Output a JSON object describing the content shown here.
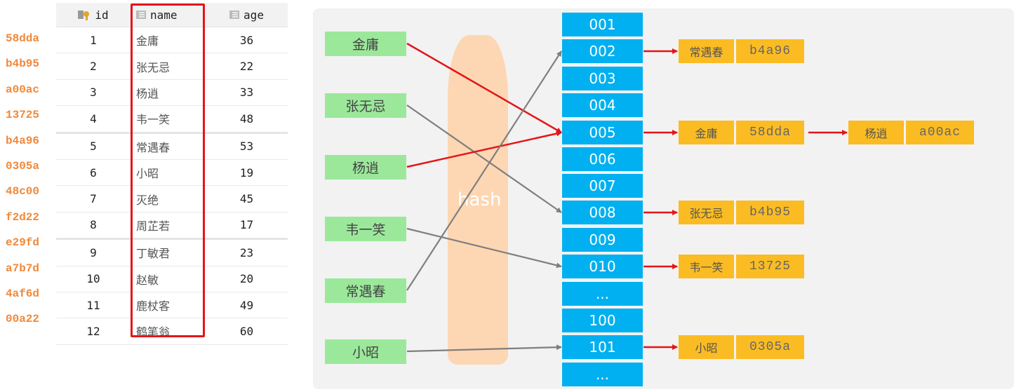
{
  "table": {
    "columns": [
      {
        "label": "id",
        "icon": "primary-key-icon"
      },
      {
        "label": "name",
        "icon": "column-icon"
      },
      {
        "label": "age",
        "icon": "column-icon"
      }
    ],
    "rows": [
      {
        "hash": "58dda",
        "id": "1",
        "name": "金庸",
        "age": "36"
      },
      {
        "hash": "b4b95",
        "id": "2",
        "name": "张无忌",
        "age": "22"
      },
      {
        "hash": "a00ac",
        "id": "3",
        "name": "杨逍",
        "age": "33"
      },
      {
        "hash": "13725",
        "id": "4",
        "name": "韦一笑",
        "age": "48"
      },
      {
        "hash": "b4a96",
        "id": "5",
        "name": "常遇春",
        "age": "53"
      },
      {
        "hash": "0305a",
        "id": "6",
        "name": "小昭",
        "age": "19"
      },
      {
        "hash": "48c00",
        "id": "7",
        "name": "灭绝",
        "age": "45"
      },
      {
        "hash": "f2d22",
        "id": "8",
        "name": "周芷若",
        "age": "17"
      },
      {
        "hash": "e29fd",
        "id": "9",
        "name": "丁敏君",
        "age": "23"
      },
      {
        "hash": "a7b7d",
        "id": "10",
        "name": "赵敏",
        "age": "20"
      },
      {
        "hash": "4af6d",
        "id": "11",
        "name": "鹿杖客",
        "age": "49"
      },
      {
        "hash": "00a22",
        "id": "12",
        "name": "鹤笔翁",
        "age": "60"
      }
    ]
  },
  "diagram": {
    "hash_label": "hash",
    "keys": [
      "金庸",
      "张无忌",
      "杨逍",
      "韦一笑",
      "常遇春",
      "小昭"
    ],
    "buckets": [
      "001",
      "002",
      "003",
      "004",
      "005",
      "006",
      "007",
      "008",
      "009",
      "010",
      "...",
      "100",
      "101",
      "..."
    ],
    "mappings": [
      {
        "key": "金庸",
        "bucket": "005",
        "color": "red"
      },
      {
        "key": "张无忌",
        "bucket": "008",
        "color": "gray"
      },
      {
        "key": "杨逍",
        "bucket": "005",
        "color": "red"
      },
      {
        "key": "韦一笑",
        "bucket": "010",
        "color": "gray"
      },
      {
        "key": "常遇春",
        "bucket": "002",
        "color": "gray"
      },
      {
        "key": "小昭",
        "bucket": "101",
        "color": "gray"
      }
    ],
    "chains": [
      {
        "bucket": "002",
        "nodes": [
          {
            "name": "常遇春",
            "hash": "b4a96"
          }
        ]
      },
      {
        "bucket": "005",
        "nodes": [
          {
            "name": "金庸",
            "hash": "58dda"
          },
          {
            "name": "杨逍",
            "hash": "a00ac"
          }
        ]
      },
      {
        "bucket": "008",
        "nodes": [
          {
            "name": "张无忌",
            "hash": "b4b95"
          }
        ]
      },
      {
        "bucket": "010",
        "nodes": [
          {
            "name": "韦一笑",
            "hash": "13725"
          }
        ]
      },
      {
        "bucket": "101",
        "nodes": [
          {
            "name": "小昭",
            "hash": "0305a"
          }
        ]
      }
    ],
    "colors": {
      "key_bg": "#9be89b",
      "bucket_bg": "#00b0f0",
      "node_bg": "#fbbc23",
      "hash_band": "#fdd7b3",
      "red_arrow": "#e3151a",
      "gray_arrow": "#7f7f7f",
      "hash_text": "#f0883a"
    }
  }
}
